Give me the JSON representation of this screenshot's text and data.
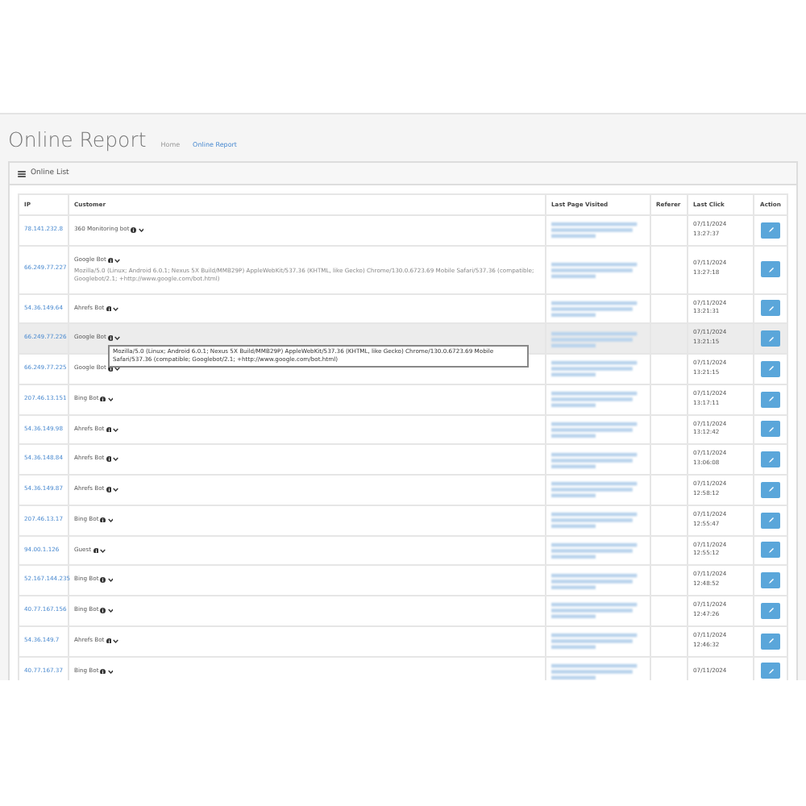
{
  "page_title": "Online Report",
  "breadcrumb": [
    "Home",
    "Online Report"
  ],
  "panel": {
    "title": "Online List"
  },
  "table": {
    "columns": [
      "IP",
      "Customer",
      "Last Page Visited",
      "Referer",
      "Last Click",
      "Action"
    ],
    "rows": [
      {
        "ip": "78.141.232.8",
        "customer": "360 Monitoring bot",
        "date": "07/11/2024",
        "time": "13:27:37",
        "hover": false
      },
      {
        "ip": "66.249.77.227",
        "customer": "Google Bot",
        "agent": "Mozilla/5.0 (Linux; Android 6.0.1; Nexus 5X Build/MMB29P) AppleWebKit/537.36 (KHTML, like Gecko) Chrome/130.0.6723.69 Mobile Safari/537.36 (compatible; Googlebot/2.1; +http://www.google.com/bot.html)",
        "date": "07/11/2024",
        "time": "13:27:18",
        "hover": false
      },
      {
        "ip": "54.36.149.64",
        "customer": "Ahrefs Bot",
        "date": "07/11/2024",
        "time": "13:21:31",
        "hover": false
      },
      {
        "ip": "66.249.77.226",
        "customer": "Google Bot",
        "tooltip": "Mozilla/5.0 (Linux; Android 6.0.1; Nexus 5X Build/MMB29P) AppleWebKit/537.36 (KHTML, like Gecko) Chrome/130.0.6723.69 Mobile Safari/537.36 (compatible; Googlebot/2.1; +http://www.google.com/bot.html)",
        "date": "07/11/2024",
        "time": "13:21:15",
        "hover": true
      },
      {
        "ip": "66.249.77.225",
        "customer": "Google Bot",
        "date": "07/11/2024",
        "time": "13:21:15",
        "hover": false
      },
      {
        "ip": "207.46.13.151",
        "customer": "Bing Bot",
        "date": "07/11/2024",
        "time": "13:17:11",
        "hover": false
      },
      {
        "ip": "54.36.149.98",
        "customer": "Ahrefs Bot",
        "date": "07/11/2024",
        "time": "13:12:42",
        "hover": false
      },
      {
        "ip": "54.36.148.84",
        "customer": "Ahrefs Bot",
        "date": "07/11/2024",
        "time": "13:06:08",
        "hover": false
      },
      {
        "ip": "54.36.149.87",
        "customer": "Ahrefs Bot",
        "date": "07/11/2024",
        "time": "12:58:12",
        "hover": false
      },
      {
        "ip": "207.46.13.17",
        "customer": "Bing Bot",
        "date": "07/11/2024",
        "time": "12:55:47",
        "hover": false
      },
      {
        "ip": "94.00.1.126",
        "customer": "Guest",
        "date": "07/11/2024",
        "time": "12:55:12",
        "hover": false
      },
      {
        "ip": "52.167.144.235",
        "customer": "Bing Bot",
        "date": "07/11/2024",
        "time": "12:48:52",
        "hover": false
      },
      {
        "ip": "40.77.167.156",
        "customer": "Bing Bot",
        "date": "07/11/2024",
        "time": "12:47:26",
        "hover": false
      },
      {
        "ip": "54.36.149.7",
        "customer": "Ahrefs Bot",
        "date": "07/11/2024",
        "time": "12:46:32",
        "hover": false
      },
      {
        "ip": "40.77.167.37",
        "customer": "Bing Bot",
        "date": "07/11/2024",
        "hover": false
      }
    ]
  }
}
